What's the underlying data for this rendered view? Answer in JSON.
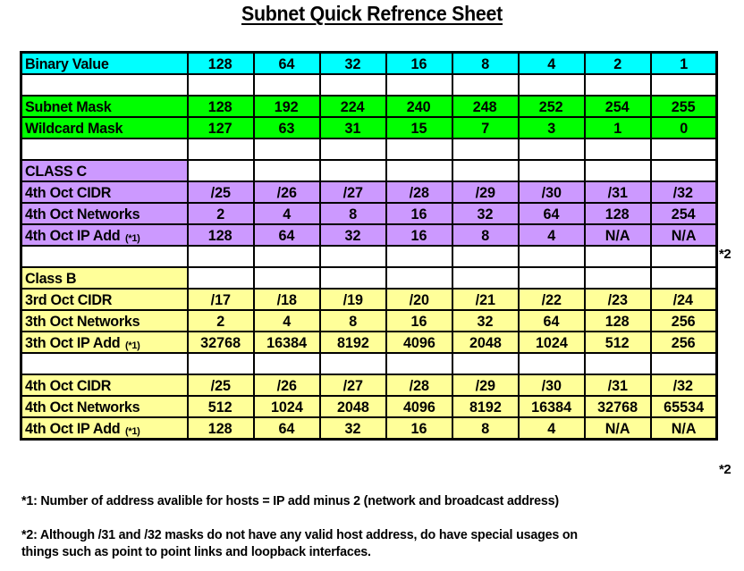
{
  "title": "Subnet Quick Refrence Sheet",
  "colors": {
    "cyan": "#00FFFF",
    "green": "#00FF00",
    "purple": "#CC99FF",
    "yellow": "#FFFF99",
    "white": "#FFFFFF",
    "border": "#000000"
  },
  "table": {
    "columns": 9,
    "rows": [
      {
        "id": "binary-value",
        "fill": "cyan",
        "label": "Binary Value",
        "values": [
          "128",
          "64",
          "32",
          "16",
          "8",
          "4",
          "2",
          "1"
        ]
      },
      {
        "id": "spacer-1",
        "fill": "white",
        "label": "",
        "values": [
          "",
          "",
          "",
          "",
          "",
          "",
          "",
          ""
        ]
      },
      {
        "id": "subnet-mask",
        "fill": "green",
        "label": "Subnet Mask",
        "values": [
          "128",
          "192",
          "224",
          "240",
          "248",
          "252",
          "254",
          "255"
        ]
      },
      {
        "id": "wildcard-mask",
        "fill": "green",
        "label": "Wildcard Mask",
        "values": [
          "127",
          "63",
          "31",
          "15",
          "7",
          "3",
          "1",
          "0"
        ]
      },
      {
        "id": "spacer-2",
        "fill": "white",
        "label": "",
        "values": [
          "",
          "",
          "",
          "",
          "",
          "",
          "",
          ""
        ]
      },
      {
        "id": "class-c-header",
        "fill": "purple",
        "label": "CLASS C",
        "label_only": true,
        "values": [
          "",
          "",
          "",
          "",
          "",
          "",
          "",
          ""
        ]
      },
      {
        "id": "class-c-4th-oct-cidr",
        "fill": "purple",
        "label": "4th Oct CIDR",
        "values": [
          "/25",
          "/26",
          "/27",
          "/28",
          "/29",
          "/30",
          "/31",
          "/32"
        ]
      },
      {
        "id": "class-c-4th-oct-networks",
        "fill": "purple",
        "label": "4th Oct Networks",
        "values": [
          "2",
          "4",
          "8",
          "16",
          "32",
          "64",
          "128",
          "254"
        ]
      },
      {
        "id": "class-c-4th-oct-ip-add",
        "fill": "purple",
        "label": "4th Oct IP Add ",
        "label_sup": "(*1)",
        "values": [
          "128",
          "64",
          "32",
          "16",
          "8",
          "4",
          "N/A",
          "N/A"
        ]
      },
      {
        "id": "spacer-3",
        "fill": "white",
        "label": "",
        "values": [
          "",
          "",
          "",
          "",
          "",
          "",
          "",
          ""
        ]
      },
      {
        "id": "class-b-header",
        "fill": "yellow",
        "label": "Class B",
        "label_only": true,
        "values": [
          "",
          "",
          "",
          "",
          "",
          "",
          "",
          ""
        ]
      },
      {
        "id": "class-b-3rd-oct-cidr",
        "fill": "yellow",
        "label": "3rd Oct CIDR",
        "values": [
          "/17",
          "/18",
          "/19",
          "/20",
          "/21",
          "/22",
          "/23",
          "/24"
        ]
      },
      {
        "id": "class-b-3th-oct-networks",
        "fill": "yellow",
        "label": "3th Oct Networks",
        "values": [
          "2",
          "4",
          "8",
          "16",
          "32",
          "64",
          "128",
          "256"
        ]
      },
      {
        "id": "class-b-3th-oct-ip-add",
        "fill": "yellow",
        "label": "3th Oct IP Add ",
        "label_sup": "(*1)",
        "values": [
          "32768",
          "16384",
          "8192",
          "4096",
          "2048",
          "1024",
          "512",
          "256"
        ]
      },
      {
        "id": "spacer-4",
        "fill": "white",
        "label": "",
        "values": [
          "",
          "",
          "",
          "",
          "",
          "",
          "",
          ""
        ]
      },
      {
        "id": "class-b-4th-oct-cidr",
        "fill": "yellow",
        "label": "4th Oct CIDR",
        "values": [
          "/25",
          "/26",
          "/27",
          "/28",
          "/29",
          "/30",
          "/31",
          "/32"
        ]
      },
      {
        "id": "class-b-4th-oct-networks",
        "fill": "yellow",
        "label": "4th Oct Networks",
        "values": [
          "512",
          "1024",
          "2048",
          "4096",
          "8192",
          "16384",
          "32768",
          "65534"
        ]
      },
      {
        "id": "class-b-4th-oct-ip-add",
        "fill": "yellow",
        "label": "4th Oct IP Add ",
        "label_sup": "(*1)",
        "values": [
          "128",
          "64",
          "32",
          "16",
          "8",
          "4",
          "N/A",
          "N/A"
        ]
      }
    ]
  },
  "markers": {
    "class_c_note": "*2",
    "class_b_note": "*2"
  },
  "footnotes": {
    "note1": "*1: Number of address avalible for hosts = IP add minus 2 (network and broadcast address)",
    "note2_line1": "*2: Although /31 and /32 masks  do not have any valid host address, do have special usages on",
    "note2_line2": "things such as point to point links and loopback interfaces."
  }
}
